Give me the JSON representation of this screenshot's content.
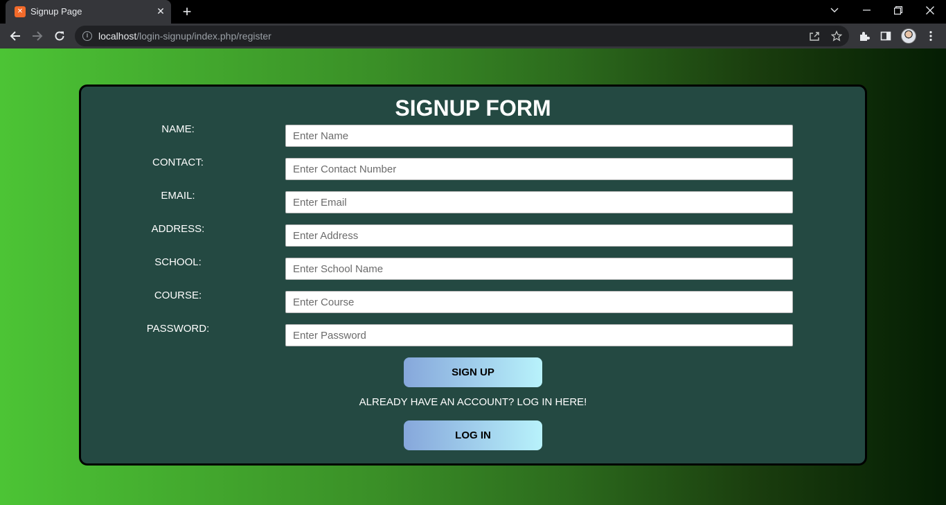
{
  "browser": {
    "tab_title": "Signup Page",
    "favicon_text": "xampp",
    "url_host": "localhost",
    "url_path": "/login-signup/index.php/register",
    "icons": [
      "back-icon",
      "forward-icon",
      "reload-icon",
      "info-icon",
      "share-icon",
      "star-icon",
      "extensions-icon",
      "side-panel-icon",
      "menu-icon"
    ]
  },
  "form": {
    "title": "SIGNUP FORM",
    "fields": [
      {
        "label": "NAME:",
        "placeholder": "Enter Name"
      },
      {
        "label": "CONTACT:",
        "placeholder": "Enter Contact Number"
      },
      {
        "label": "EMAIL:",
        "placeholder": "Enter Email"
      },
      {
        "label": "ADDRESS:",
        "placeholder": "Enter Address"
      },
      {
        "label": "SCHOOL:",
        "placeholder": "Enter School Name"
      },
      {
        "label": "COURSE:",
        "placeholder": "Enter Course"
      },
      {
        "label": "PASSWORD:",
        "placeholder": "Enter Password"
      }
    ],
    "signup_button": "SIGN UP",
    "login_prompt": "ALREADY HAVE AN ACCOUNT? LOG IN HERE!",
    "login_button": "LOG IN"
  },
  "colors": {
    "card_background": "#244942",
    "button_gradient_start": "#86a7db",
    "button_gradient_end": "#b8f2fb",
    "page_gradient_start": "#4cc435",
    "page_gradient_end": "#041d03"
  }
}
